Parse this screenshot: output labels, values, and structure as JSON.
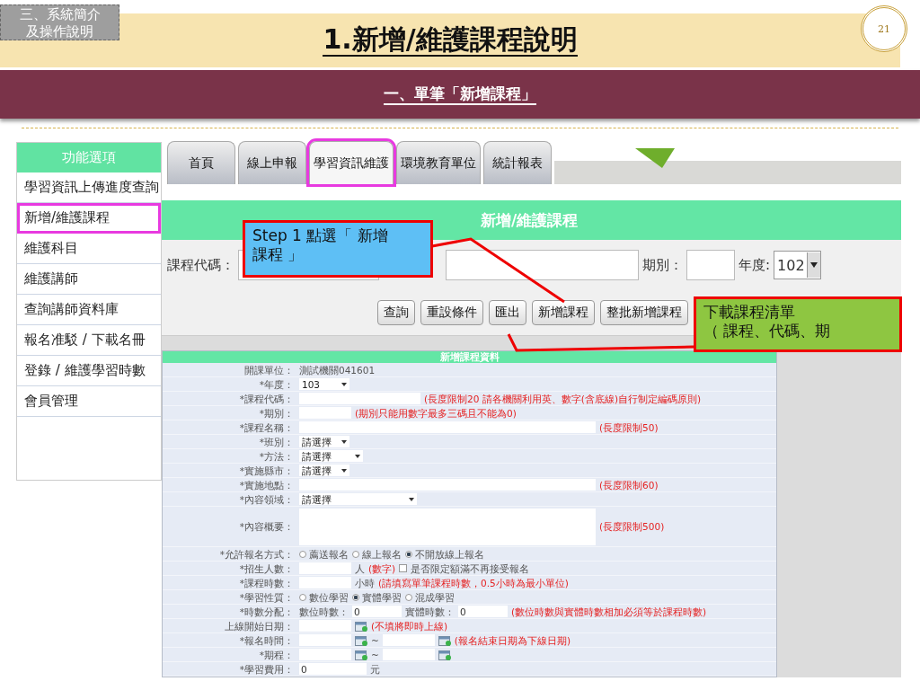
{
  "slide": {
    "section_tag": [
      "三、系統簡介",
      "及操作說明"
    ],
    "title": "1.新增/維護課程說明",
    "page_number": "21",
    "subtitle": "一、單筆「新增課程」"
  },
  "sidebar": {
    "header": "功能選項",
    "items": [
      {
        "label": "學習資訊上傳進度查詢",
        "selected": false
      },
      {
        "label": "新增/維護課程",
        "selected": true
      },
      {
        "label": "維護科目",
        "selected": false
      },
      {
        "label": "維護講師",
        "selected": false
      },
      {
        "label": "查詢講師資料庫",
        "selected": false
      },
      {
        "label": "報名准駁 / 下載名冊",
        "selected": false
      },
      {
        "label": "登錄 / 維護學習時數",
        "selected": false
      },
      {
        "label": "會員管理",
        "selected": false
      }
    ]
  },
  "tabs": [
    {
      "label": "首頁",
      "selected": false
    },
    {
      "label": "線上申報",
      "selected": false
    },
    {
      "label": "學習資訊維護",
      "selected": true
    },
    {
      "label": "環境教育單位",
      "selected": false
    },
    {
      "label": "統計報表",
      "selected": false
    }
  ],
  "search_panel": {
    "title": "新增/維護課程",
    "fields": [
      {
        "kind": "field",
        "label": "課程代碼："
      },
      {
        "kind": "covered-field"
      },
      {
        "kind": "short-field",
        "label": "期別："
      },
      {
        "kind": "select",
        "label": "年度:",
        "value": "102"
      }
    ],
    "buttons": [
      "查詢",
      "重設條件",
      "匯出",
      "新增課程",
      "整批新增課程"
    ]
  },
  "callouts": [
    {
      "color": "#5ebff5",
      "lines": [
        "Step 1 點選「 新增",
        "課程 」"
      ]
    },
    {
      "color": "#8ec641",
      "lines": [
        "下載課程清單",
        "（ 課程、代碼、期"
      ]
    }
  ],
  "form": {
    "title": "新增課程資料",
    "rows": [
      {
        "label": "開課單位：",
        "parts": [
          {
            "kind": "text",
            "text": "測試機關041601"
          }
        ]
      },
      {
        "label": "*年度：",
        "parts": [
          {
            "kind": "select",
            "value": "103"
          }
        ]
      },
      {
        "label": "*課程代碼：",
        "parts": [
          {
            "kind": "field"
          },
          {
            "kind": "note",
            "text": "(長度限制20 請各機關利用英、數字(含底線)自行制定編碼原則)"
          }
        ]
      },
      {
        "label": "*期別：",
        "parts": [
          {
            "kind": "short-field"
          },
          {
            "kind": "note",
            "text": "(期別只能用數字最多三碼且不能為0)"
          }
        ]
      },
      {
        "label": "*課程名稱：",
        "parts": [
          {
            "kind": "long-field"
          },
          {
            "kind": "note",
            "text": "(長度限制50)"
          }
        ]
      },
      {
        "label": "*班別：",
        "parts": [
          {
            "kind": "select",
            "value": "請選擇"
          }
        ]
      },
      {
        "label": "*方法：",
        "parts": [
          {
            "kind": "select-wide",
            "value": "請選擇"
          }
        ]
      },
      {
        "label": "*實施縣市：",
        "parts": [
          {
            "kind": "select",
            "value": "請選擇"
          }
        ]
      },
      {
        "label": "*實施地點：",
        "parts": [
          {
            "kind": "long-field"
          },
          {
            "kind": "note",
            "text": "(長度限制60)"
          }
        ]
      },
      {
        "label": "*內容領域：",
        "parts": [
          {
            "kind": "select-long",
            "value": "請選擇"
          }
        ]
      },
      {
        "label": "*內容概要：",
        "parts": [
          {
            "kind": "textarea"
          },
          {
            "kind": "note",
            "text": "(長度限制500)"
          }
        ]
      },
      {
        "label": "*允許報名方式：",
        "parts": [
          {
            "kind": "radio",
            "label": "薦送報名",
            "selected": false
          },
          {
            "kind": "radio",
            "label": "線上報名",
            "selected": false
          },
          {
            "kind": "radio",
            "label": "不開放線上報名",
            "selected": true
          }
        ]
      },
      {
        "label": "*招生人數：",
        "parts": [
          {
            "kind": "short-field"
          },
          {
            "kind": "text",
            "text": "人"
          },
          {
            "kind": "note",
            "text": "(數字)"
          },
          {
            "kind": "checkbox",
            "label": "是否限定額滿不再接受報名",
            "checked": false
          }
        ]
      },
      {
        "label": "*課程時數：",
        "parts": [
          {
            "kind": "short-field"
          },
          {
            "kind": "text",
            "text": "小時"
          },
          {
            "kind": "note",
            "text": "(請填寫單筆課程時數，0.5小時為最小單位)"
          }
        ]
      },
      {
        "label": "*學習性質：",
        "parts": [
          {
            "kind": "radio",
            "label": "數位學習",
            "selected": false
          },
          {
            "kind": "radio",
            "label": "實體學習",
            "selected": true
          },
          {
            "kind": "radio",
            "label": "混成學習",
            "selected": false
          }
        ]
      },
      {
        "label": "*時數分配：",
        "parts": [
          {
            "kind": "text",
            "text": "數位時數："
          },
          {
            "kind": "tiny-field",
            "value": "0"
          },
          {
            "kind": "text",
            "text": "實體時數："
          },
          {
            "kind": "tiny-field",
            "value": "0"
          },
          {
            "kind": "note",
            "text": "(數位時數與實體時數相加必須等於課程時數)"
          }
        ]
      },
      {
        "label": "上線開始日期：",
        "parts": [
          {
            "kind": "date-field"
          },
          {
            "kind": "note",
            "text": "(不填將即時上線)"
          }
        ]
      },
      {
        "label": "*報名時間：",
        "parts": [
          {
            "kind": "date-field"
          },
          {
            "kind": "text",
            "text": "~"
          },
          {
            "kind": "date-field"
          },
          {
            "kind": "note",
            "text": "(報名結束日期為下線日期)"
          }
        ]
      },
      {
        "label": "*期程：",
        "parts": [
          {
            "kind": "date-field"
          },
          {
            "kind": "text",
            "text": "~"
          },
          {
            "kind": "date-field"
          }
        ]
      },
      {
        "label": "*學習費用：",
        "parts": [
          {
            "kind": "field-money",
            "value": "0"
          },
          {
            "kind": "text",
            "text": "元"
          }
        ]
      }
    ]
  }
}
